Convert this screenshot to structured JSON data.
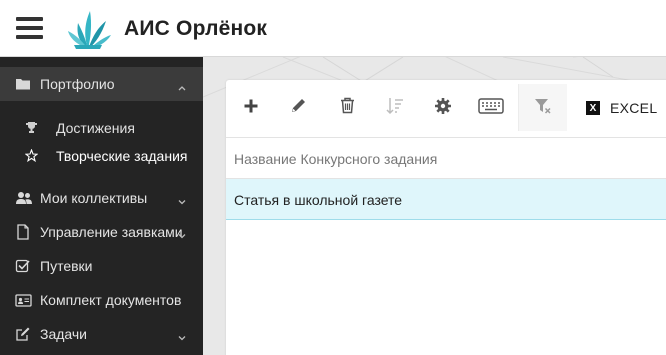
{
  "app": {
    "title": "АИС Орлёнок"
  },
  "sidebar": {
    "items": [
      {
        "label": "Портфолио",
        "icon": "folder-icon",
        "expanded": true
      },
      {
        "label": "Мои коллективы",
        "icon": "users-icon",
        "expanded": false
      },
      {
        "label": "Управление заявками",
        "icon": "document-icon",
        "expanded": false
      },
      {
        "label": "Путевки",
        "icon": "checkbox-icon"
      },
      {
        "label": "Комплект документов",
        "icon": "id-card-icon"
      },
      {
        "label": "Задачи",
        "icon": "edit-square-icon",
        "expanded": false
      }
    ],
    "portfolio_children": [
      {
        "label": "Достижения",
        "icon": "trophy-icon"
      },
      {
        "label": "Творческие задания",
        "icon": "star-icon",
        "current": true
      }
    ]
  },
  "toolbar": {
    "buttons": [
      "add-icon",
      "edit-icon",
      "delete-icon",
      "sort-icon",
      "settings-icon",
      "keyboard-icon",
      "clear-filter-icon"
    ],
    "excel_label": "EXCEL"
  },
  "table": {
    "columns": [
      "Название Конкурсного задания"
    ],
    "rows": [
      [
        "Статья в школьной газете"
      ]
    ]
  },
  "colors": {
    "sidebar_bg": "#242424",
    "sidebar_active_bg": "#3b3b3b",
    "selected_row_bg": "#dff6fb",
    "selected_row_border": "#9edcea",
    "logo_teal": "#2aa7b8"
  }
}
